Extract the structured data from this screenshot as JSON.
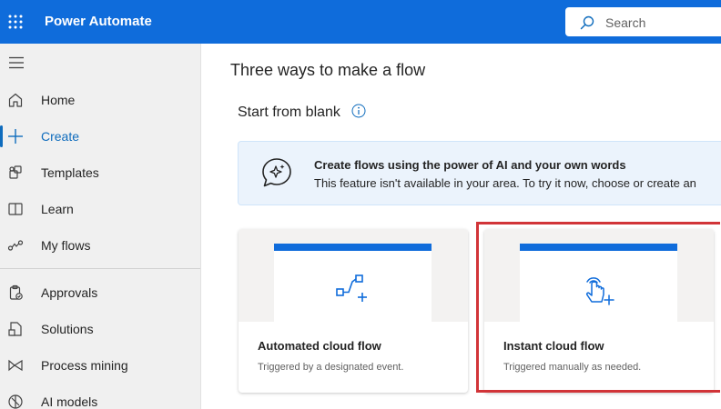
{
  "header": {
    "app_title": "Power Automate",
    "search_placeholder": "Search",
    "brand_color": "#0f6cdb"
  },
  "sidebar": {
    "items": [
      {
        "label": "Home",
        "icon": "home-icon",
        "active": false
      },
      {
        "label": "Create",
        "icon": "plus-icon",
        "active": true
      },
      {
        "label": "Templates",
        "icon": "templates-icon",
        "active": false
      },
      {
        "label": "Learn",
        "icon": "book-icon",
        "active": false
      },
      {
        "label": "My flows",
        "icon": "flows-icon",
        "active": false
      },
      {
        "label": "Approvals",
        "icon": "clipboard-check-icon",
        "active": false
      },
      {
        "label": "Solutions",
        "icon": "solutions-icon",
        "active": false
      },
      {
        "label": "Process mining",
        "icon": "process-mining-icon",
        "active": false
      },
      {
        "label": "AI models",
        "icon": "ai-models-icon",
        "active": false
      }
    ]
  },
  "main": {
    "heading": "Three ways to make a flow",
    "subheading": "Start from blank",
    "ai_banner": {
      "title": "Create flows using the power of AI and your own words",
      "description": "This feature isn't available in your area. To try it now, choose or create an"
    },
    "cards": [
      {
        "title": "Automated cloud flow",
        "description": "Triggered by a designated event.",
        "icon": "automated-flow-icon"
      },
      {
        "title": "Instant cloud flow",
        "description": "Triggered manually as needed.",
        "icon": "touch-hand-icon",
        "highlighted": true
      }
    ],
    "highlight_color": "#d13438"
  }
}
